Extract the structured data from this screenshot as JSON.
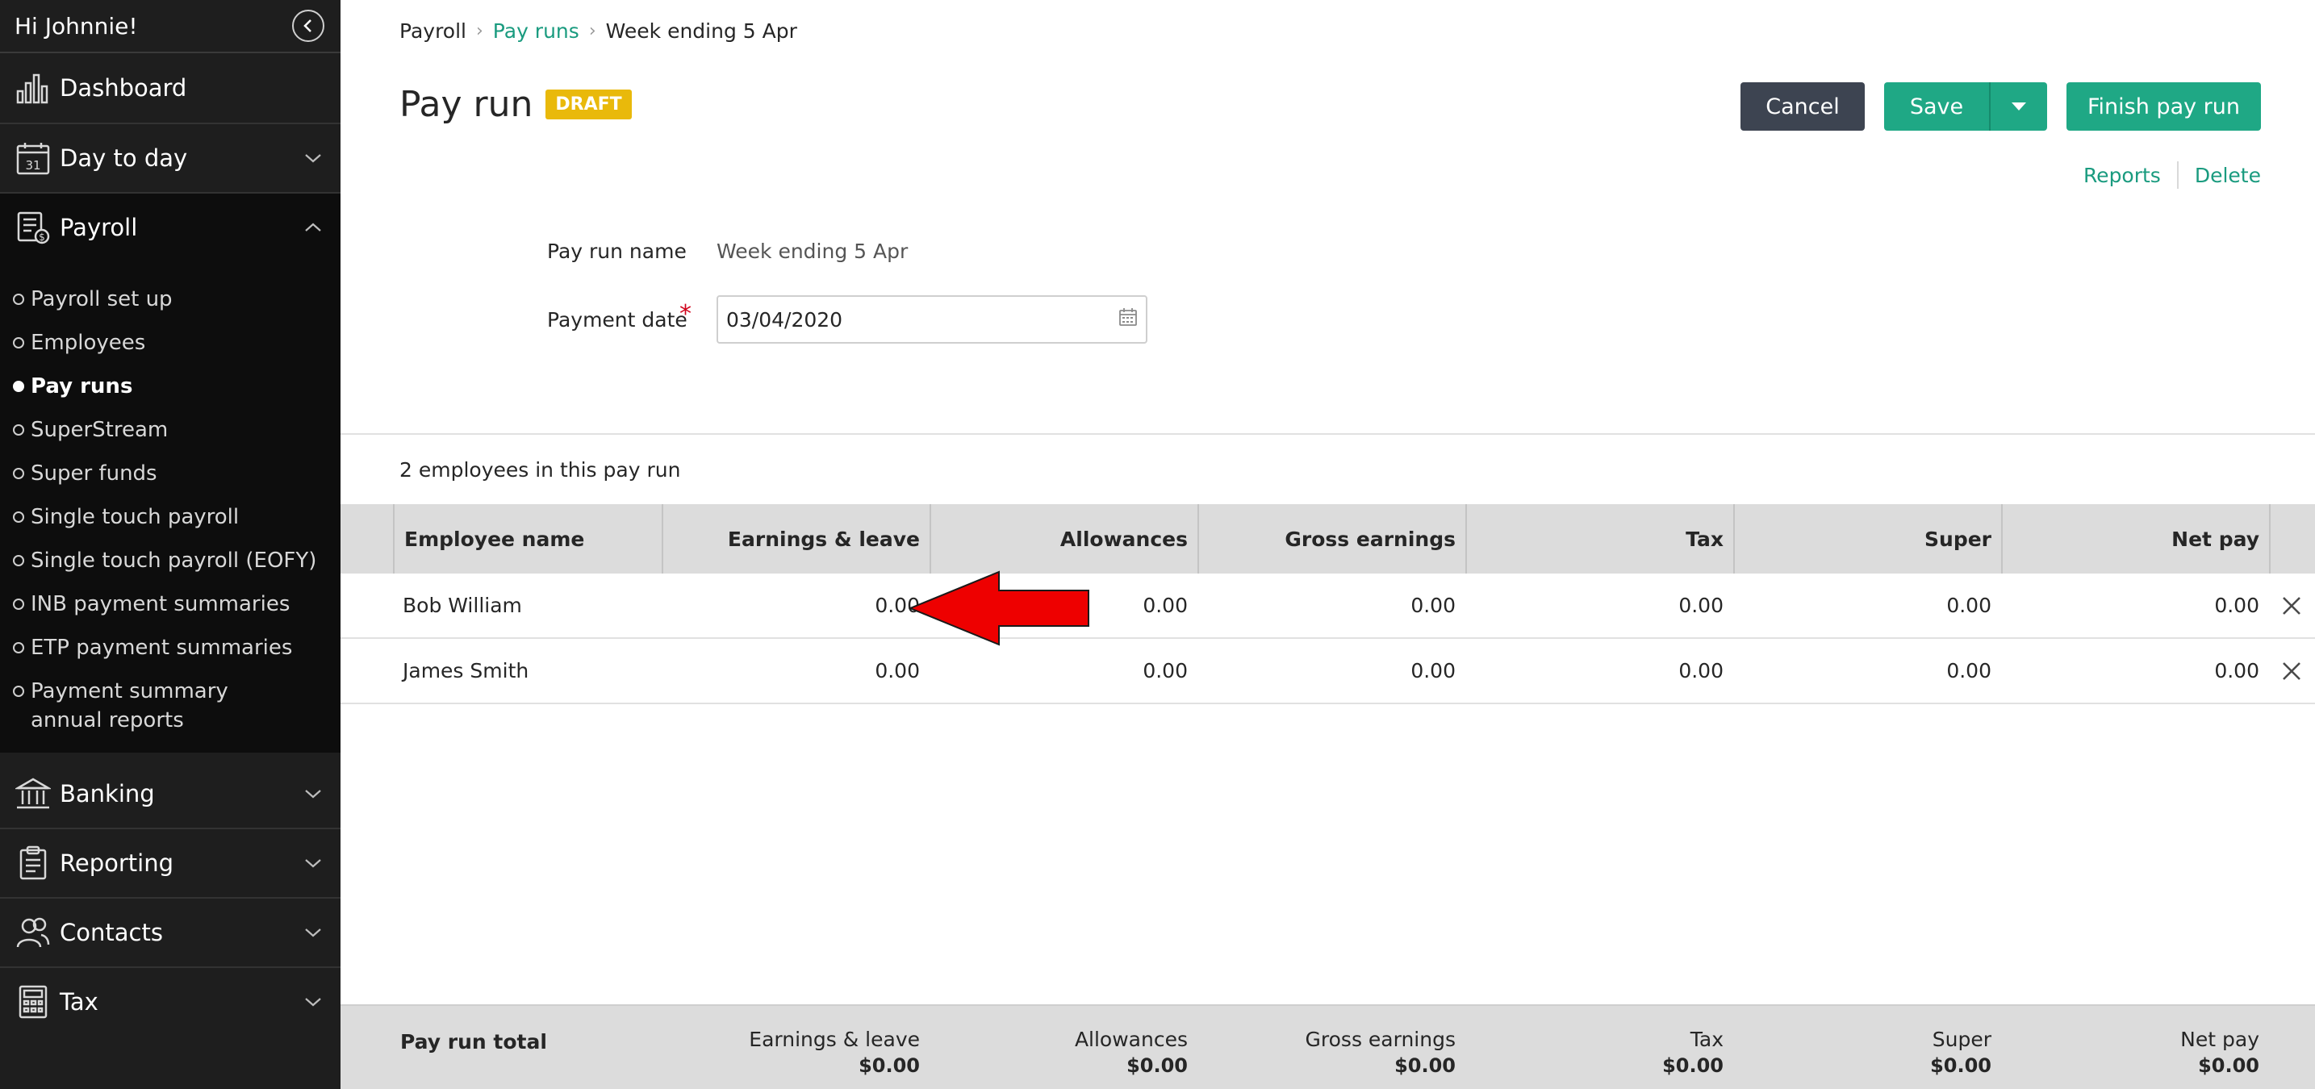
{
  "sidebar": {
    "greeting": "Hi Johnnie!",
    "nav": [
      {
        "label": "Dashboard",
        "icon": "bar-chart-icon"
      },
      {
        "label": "Day to day",
        "icon": "calendar-icon",
        "calendar_day": "31"
      },
      {
        "label": "Payroll",
        "icon": "payroll-icon"
      },
      {
        "label": "Banking",
        "icon": "bank-icon"
      },
      {
        "label": "Reporting",
        "icon": "clipboard-icon"
      },
      {
        "label": "Contacts",
        "icon": "contacts-icon"
      },
      {
        "label": "Tax",
        "icon": "calculator-icon"
      }
    ],
    "payroll_items": [
      "Payroll set up",
      "Employees",
      "Pay runs",
      "SuperStream",
      "Super funds",
      "Single touch payroll",
      "Single touch payroll (EOFY)",
      "INB payment summaries",
      "ETP payment summaries",
      "Payment summary annual reports"
    ],
    "current_item": "Pay runs"
  },
  "breadcrumb": {
    "root": "Payroll",
    "parent": "Pay runs",
    "current": "Week ending 5 Apr"
  },
  "page": {
    "title": "Pay run",
    "status_badge": "DRAFT"
  },
  "actions": {
    "cancel": "Cancel",
    "save": "Save",
    "finish": "Finish pay run",
    "reports": "Reports",
    "delete": "Delete"
  },
  "form": {
    "name_label": "Pay run name",
    "name_value": "Week ending 5 Apr",
    "date_label": "Payment date",
    "required_mark": "*",
    "date_value": "03/04/2020"
  },
  "summary": {
    "employee_count": "2 employees in this pay run"
  },
  "table": {
    "columns": [
      "Employee name",
      "Earnings & leave",
      "Allowances",
      "Gross earnings",
      "Tax",
      "Super",
      "Net pay"
    ],
    "rows": [
      {
        "name": "Bob William",
        "earnings": "0.00",
        "allowances": "0.00",
        "gross": "0.00",
        "tax": "0.00",
        "super": "0.00",
        "net": "0.00"
      },
      {
        "name": "James Smith",
        "earnings": "0.00",
        "allowances": "0.00",
        "gross": "0.00",
        "tax": "0.00",
        "super": "0.00",
        "net": "0.00"
      }
    ]
  },
  "totals": {
    "title": "Pay run total",
    "items": [
      {
        "label": "Earnings & leave",
        "value": "$0.00"
      },
      {
        "label": "Allowances",
        "value": "$0.00"
      },
      {
        "label": "Gross earnings",
        "value": "$0.00"
      },
      {
        "label": "Tax",
        "value": "$0.00"
      },
      {
        "label": "Super",
        "value": "$0.00"
      },
      {
        "label": "Net pay",
        "value": "$0.00"
      }
    ]
  },
  "colors": {
    "accent": "#1fa885",
    "badge": "#e9b90b",
    "sidebar": "#1e1e1e",
    "annotation_arrow": "#ee0000"
  }
}
